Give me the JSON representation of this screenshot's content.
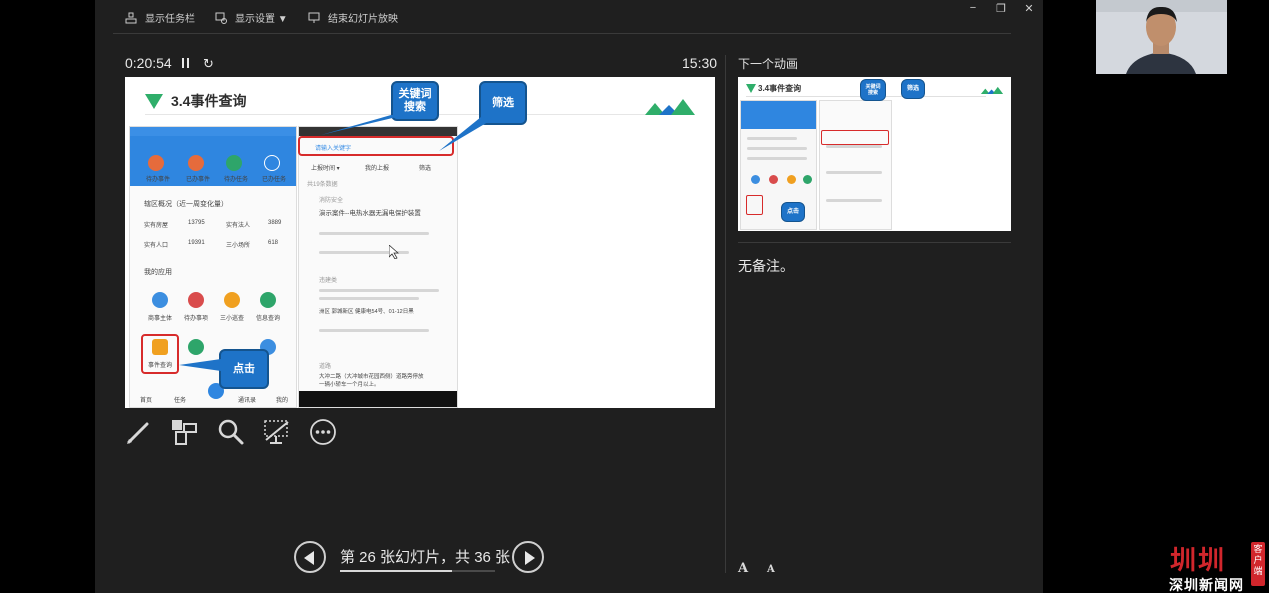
{
  "toolbar": {
    "show_taskbar": "显示任务栏",
    "display_settings": "显示设置 ▼",
    "end_slideshow": "结束幻灯片放映",
    "minimize": "−",
    "restore": "❐",
    "close": "✕"
  },
  "timer": {
    "elapsed": "0:20:54",
    "reset_icon": "↻",
    "clock": "15:30"
  },
  "slide": {
    "title": "3.4事件查询",
    "callout_keyword": "关键词\n搜索",
    "callout_filter": "筛选",
    "callout_click": "点击",
    "phone_left": {
      "stats_title": "辖区概况（近一周变化量）",
      "stat1_label": "实有房屋",
      "stat1_value": "13795",
      "stat2_label": "实有法人",
      "stat2_value": "3889",
      "stat3_label": "实有人口",
      "stat3_value": "19391",
      "stat4_label": "三小场所",
      "stat4_value": "618",
      "apps_title": "我的应用",
      "app1": "商事主体",
      "app2": "待办事项",
      "app3": "三小巡查",
      "app4": "信息查询",
      "app_event": "事件查询",
      "top1": "待办事件",
      "top2": "已办事件",
      "top3": "待办任务",
      "top4": "已办任务",
      "tab1": "首页",
      "tab2": "任务",
      "tab3": "通讯录",
      "tab4": "我的"
    },
    "phone_right": {
      "search_placeholder": "请输入关键字",
      "filter1": "上报时间 ▾",
      "filter2": "我的上报",
      "filter3": "筛选",
      "section": "共19条数据",
      "item1_tag": "消防安全",
      "item1_title": "演示案件--电热水器无漏电保护装置",
      "item2_tag": "违建类",
      "item2_text": "洲区 郭城新区 健康电54号、01-12日黑",
      "item3_tag": "道路",
      "item3_text": "大冲二路（大冲城市花园西侧）道路旁停放一辆小轿车一个月以上。"
    }
  },
  "tools": {
    "pen": "pen-icon",
    "see_all": "see-all-slides-icon",
    "zoom": "zoom-icon",
    "black_screen": "black-screen-icon",
    "more": "more-options-icon"
  },
  "navigation": {
    "slide_counter": "第 26 张幻灯片，共 36 张",
    "current": 26,
    "total": 36
  },
  "next_pane": {
    "label": "下一个动画",
    "notes": "无备注。",
    "font_larger": "A",
    "font_smaller": "A"
  },
  "next_slide": {
    "title": "3.4事件查询",
    "callout1": "关键词\n搜索",
    "callout2": "筛选",
    "callout3": "点击"
  },
  "watermark": {
    "logo_main": "圳圳",
    "logo_sub": "深圳新闻网",
    "logo_tag": "客户端"
  },
  "colors": {
    "accent_green": "#2fae6a",
    "callout_blue": "#1e73c8",
    "highlight_red": "#d72b2b",
    "logo_red": "#d1262c"
  }
}
